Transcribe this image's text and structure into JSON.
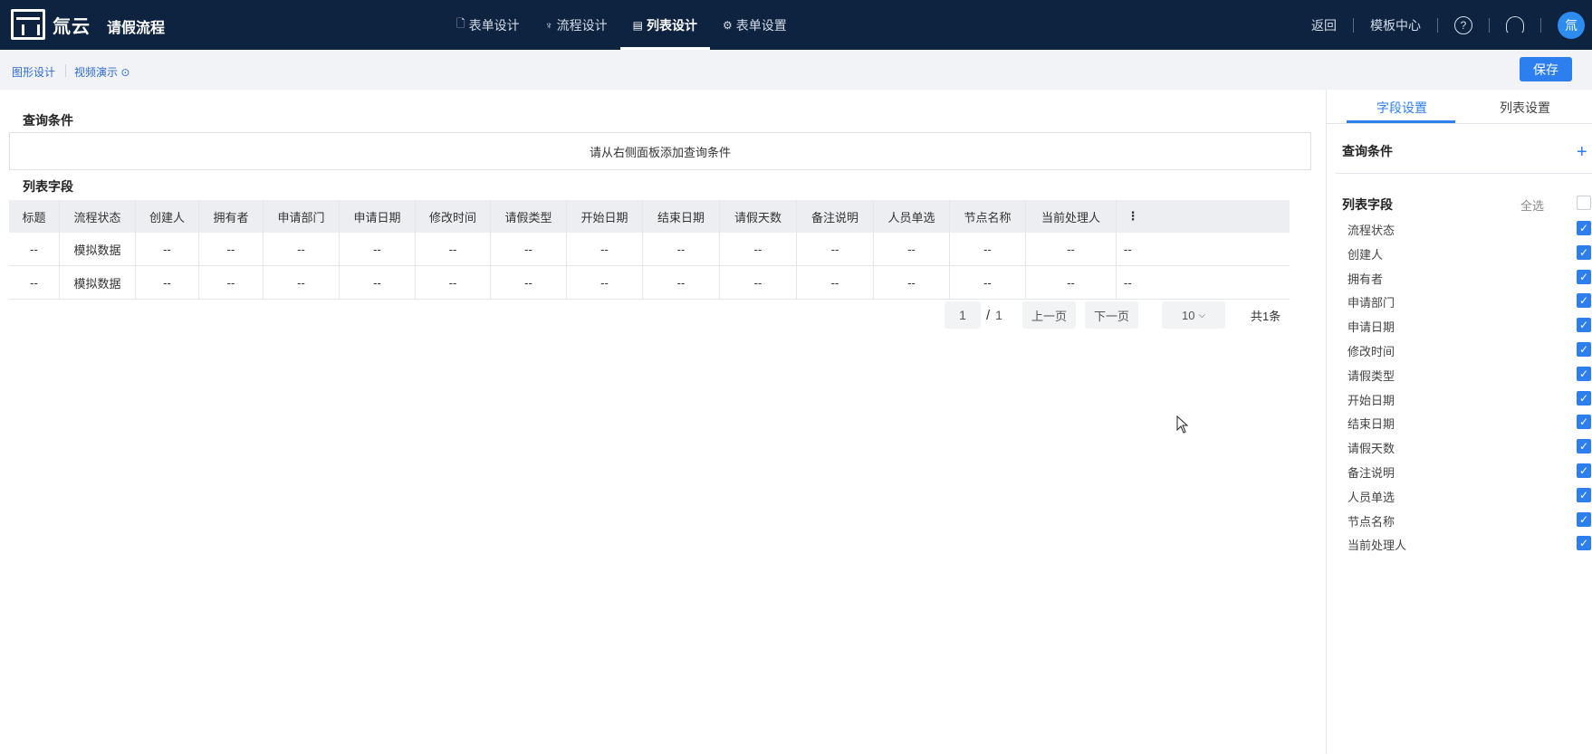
{
  "header": {
    "logo_text": "氚云",
    "app_title": "请假流程",
    "tabs": [
      {
        "label": "表单设计",
        "icon": "form-icon"
      },
      {
        "label": "流程设计",
        "icon": "flow-icon"
      },
      {
        "label": "列表设计",
        "icon": "list-icon",
        "active": true
      },
      {
        "label": "表单设置",
        "icon": "gear-icon"
      }
    ],
    "back_label": "返回",
    "template_label": "模板中心",
    "help_icon": "?",
    "avatar_text": "氚"
  },
  "subbar": {
    "graphic_design": "图形设计",
    "video_demo": "视频演示",
    "save_label": "保存"
  },
  "main": {
    "query_title": "查询条件",
    "query_placeholder": "请从右侧面板添加查询条件",
    "list_title": "列表字段",
    "columns": [
      "标题",
      "流程状态",
      "创建人",
      "拥有者",
      "申请部门",
      "申请日期",
      "修改时间",
      "请假类型",
      "开始日期",
      "结束日期",
      "请假天数",
      "备注说明",
      "人员单选",
      "节点名称",
      "当前处理人",
      "⋮"
    ],
    "rows": [
      [
        "--",
        "模拟数据",
        "--",
        "--",
        "--",
        "--",
        "--",
        "--",
        "--",
        "--",
        "--",
        "--",
        "--",
        "--",
        "--",
        "--"
      ],
      [
        "--",
        "模拟数据",
        "--",
        "--",
        "--",
        "--",
        "--",
        "--",
        "--",
        "--",
        "--",
        "--",
        "--",
        "--",
        "--",
        "--"
      ]
    ],
    "pager": {
      "current": "1",
      "slash": "/",
      "total_pages": "1",
      "prev": "上一页",
      "next": "下一页",
      "page_size": "10",
      "count": "共1条"
    }
  },
  "panel": {
    "tabs": [
      "字段设置",
      "列表设置"
    ],
    "query_title": "查询条件",
    "plus": "+",
    "list_title": "列表字段",
    "select_all": "全选",
    "fields": [
      "流程状态",
      "创建人",
      "拥有者",
      "申请部门",
      "申请日期",
      "修改时间",
      "请假类型",
      "开始日期",
      "结束日期",
      "请假天数",
      "备注说明",
      "人员单选",
      "节点名称",
      "当前处理人"
    ]
  },
  "colors": {
    "topbar": "#0e2340",
    "accent": "#2d7ff0",
    "subbar": "#f1f3f6"
  }
}
